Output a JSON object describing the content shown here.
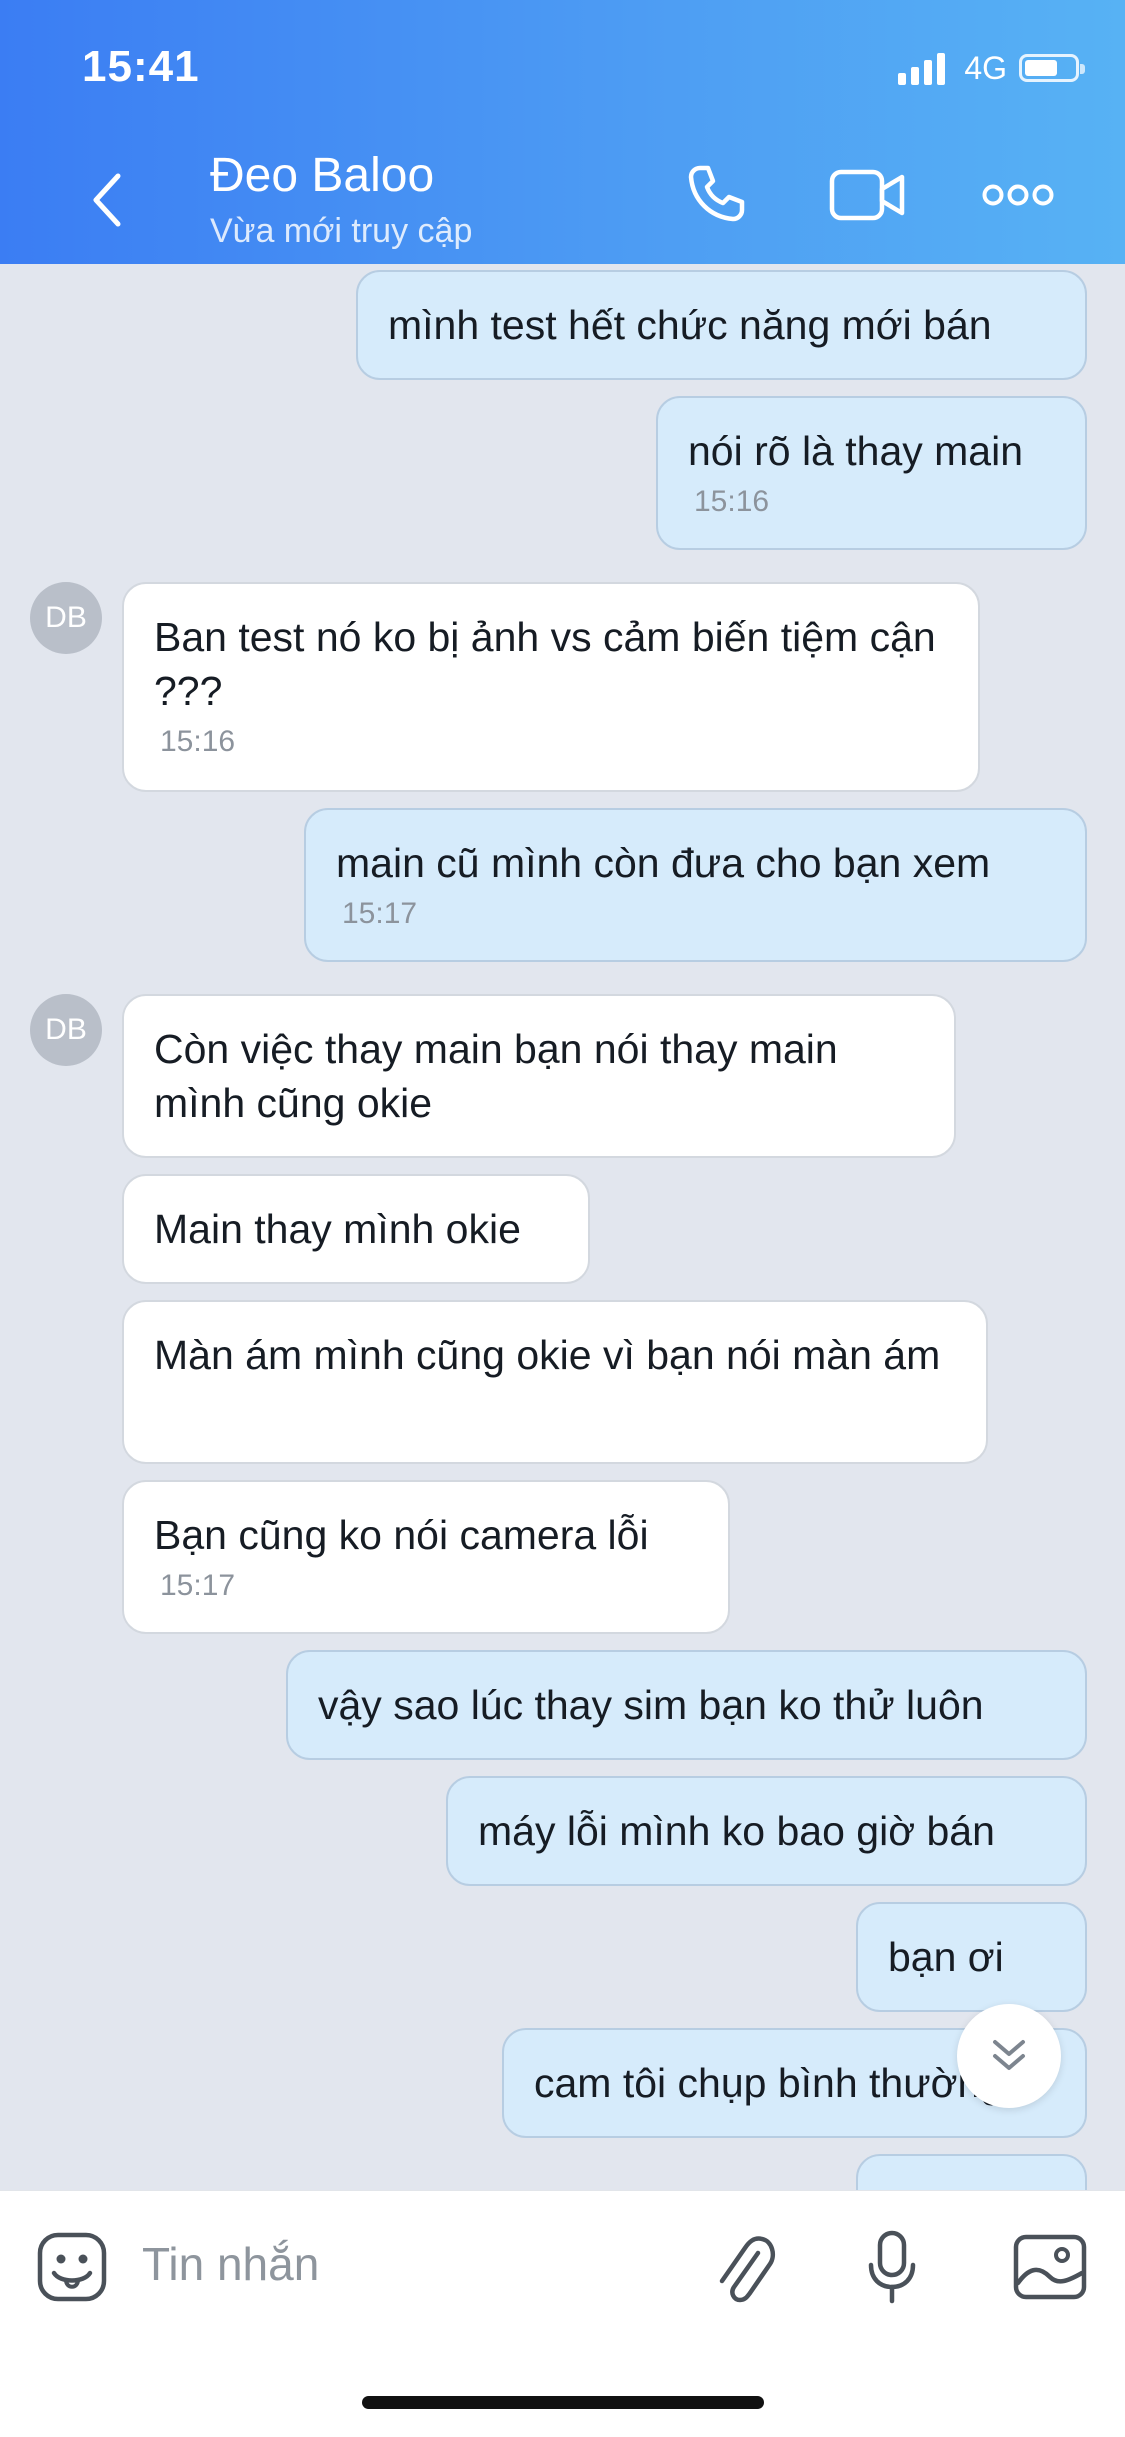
{
  "status_bar": {
    "time": "15:41",
    "network": "4G"
  },
  "header": {
    "contact_name": "Đeo Baloo",
    "presence": "Vừa mới truy cập"
  },
  "messages": [
    {
      "dir": "out",
      "text": "mình test hết chức năng mới bán"
    },
    {
      "dir": "out",
      "text": "nói rõ là thay main",
      "time": "15:16"
    },
    {
      "dir": "in",
      "avatar": "DB",
      "text": "Ban test nó ko bị ảnh vs cảm biến tiệm cận ???",
      "time": "15:16"
    },
    {
      "dir": "out",
      "text": "main cũ mình còn đưa cho bạn xem",
      "time": "15:17"
    },
    {
      "dir": "in",
      "avatar": "DB",
      "text": "Còn việc thay main bạn nói thay main mình cũng okie"
    },
    {
      "dir": "in",
      "text": "Main thay mình okie"
    },
    {
      "dir": "in",
      "text": "Màn ám mình cũng okie vì bạn nói màn ám"
    },
    {
      "dir": "in",
      "text": "Bạn cũng ko nói camera lỗi",
      "time": "15:17"
    },
    {
      "dir": "out",
      "text": "vậy sao lúc thay sim bạn ko thử luôn"
    },
    {
      "dir": "out",
      "text": "máy lỗi mình ko bao giờ bán"
    },
    {
      "dir": "out",
      "text": "bạn ơi"
    },
    {
      "dir": "out",
      "text": "cam tôi chụp bình thường"
    },
    {
      "dir": "out",
      "text": ""
    }
  ],
  "input": {
    "placeholder": "Tin nhắn"
  }
}
